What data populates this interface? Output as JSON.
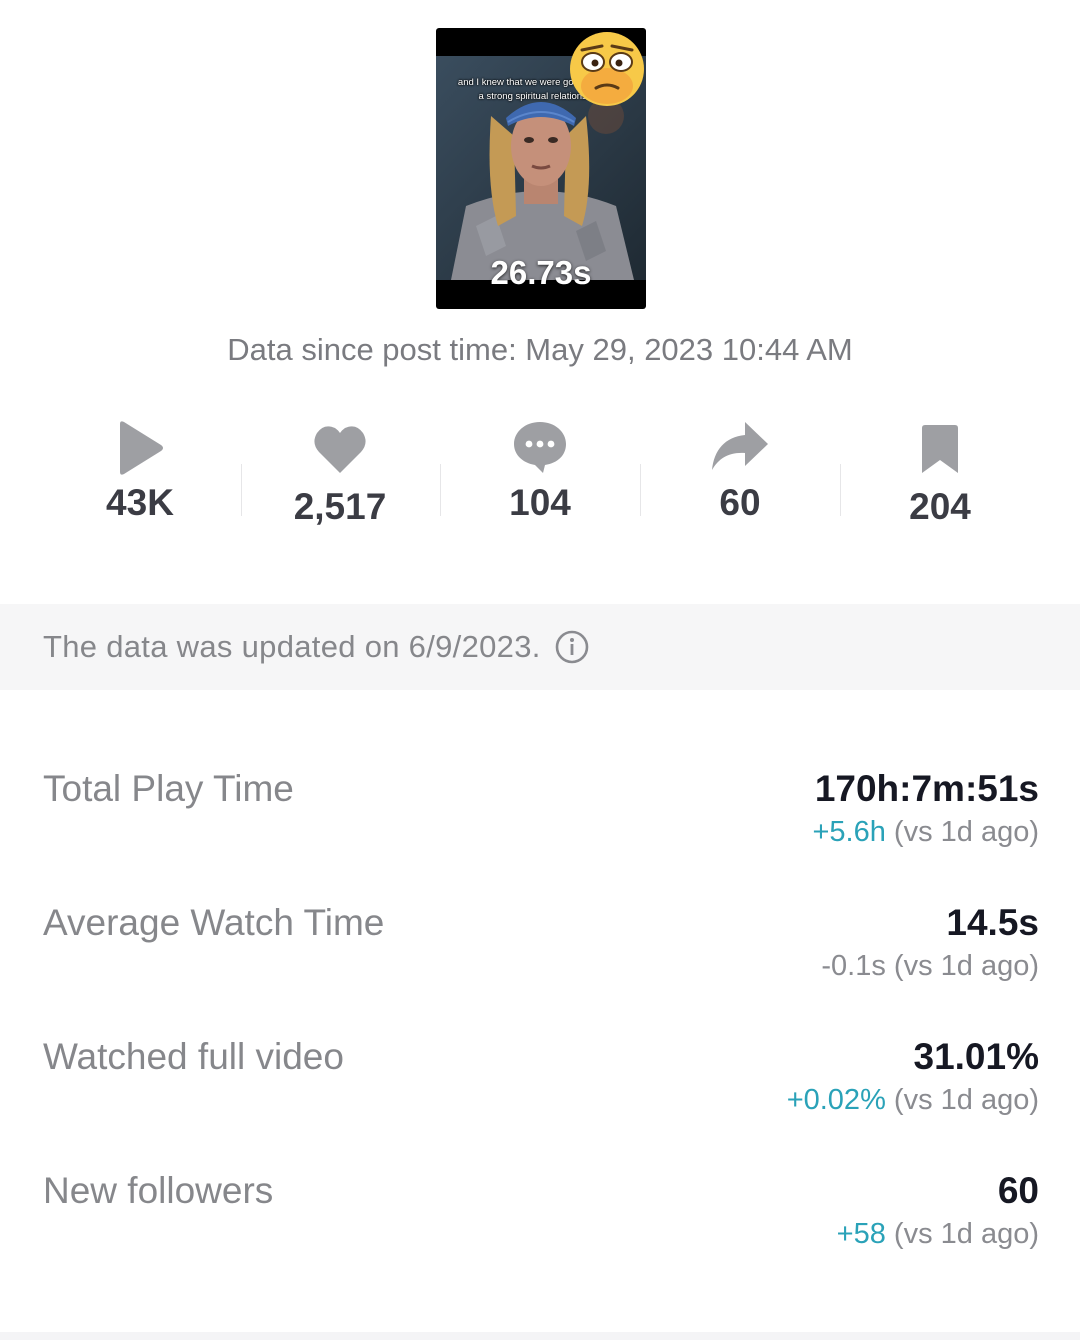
{
  "video": {
    "duration": "26.73s",
    "caption": "and I knew that we were going to have a strong spiritual relationship"
  },
  "post_info": "Data since post time: May 29, 2023 10:44 AM",
  "stats": [
    {
      "icon": "play-icon",
      "value": "43K"
    },
    {
      "icon": "heart-icon",
      "value": "2,517"
    },
    {
      "icon": "comment-icon",
      "value": "104"
    },
    {
      "icon": "share-icon",
      "value": "60"
    },
    {
      "icon": "bookmark-icon",
      "value": "204"
    }
  ],
  "update_notice": "The data was updated on 6/9/2023.",
  "metrics": [
    {
      "label": "Total Play Time",
      "value": "170h:7m:51s",
      "change": "+5.6h",
      "compare": " (vs 1d ago)"
    },
    {
      "label": "Average Watch Time",
      "value": "14.5s",
      "change": "-0.1s",
      "compare": " (vs 1d ago)"
    },
    {
      "label": "Watched full video",
      "value": "31.01%",
      "change": "+0.02%",
      "compare": " (vs 1d ago)"
    },
    {
      "label": "New followers",
      "value": "60",
      "change": "+58",
      "compare": " (vs 1d ago)"
    }
  ],
  "colors": {
    "positive_change": "#2aa2b8",
    "icon_gray": "#9e9fa3"
  }
}
